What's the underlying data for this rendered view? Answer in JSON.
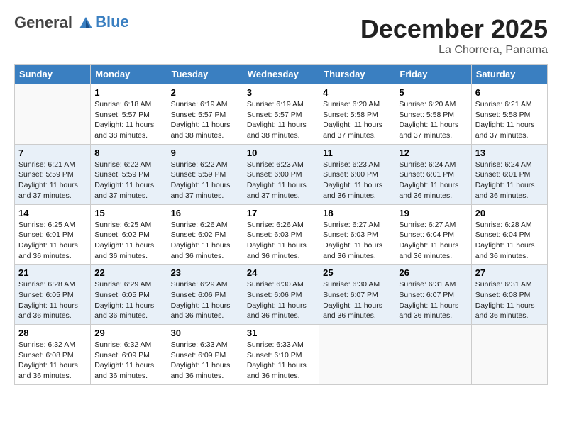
{
  "header": {
    "logo_line1": "General",
    "logo_line2": "Blue",
    "month": "December 2025",
    "location": "La Chorrera, Panama"
  },
  "weekdays": [
    "Sunday",
    "Monday",
    "Tuesday",
    "Wednesday",
    "Thursday",
    "Friday",
    "Saturday"
  ],
  "weeks": [
    [
      {
        "day": "",
        "sunrise": "",
        "sunset": "",
        "daylight": ""
      },
      {
        "day": "1",
        "sunrise": "Sunrise: 6:18 AM",
        "sunset": "Sunset: 5:57 PM",
        "daylight": "Daylight: 11 hours and 38 minutes."
      },
      {
        "day": "2",
        "sunrise": "Sunrise: 6:19 AM",
        "sunset": "Sunset: 5:57 PM",
        "daylight": "Daylight: 11 hours and 38 minutes."
      },
      {
        "day": "3",
        "sunrise": "Sunrise: 6:19 AM",
        "sunset": "Sunset: 5:57 PM",
        "daylight": "Daylight: 11 hours and 38 minutes."
      },
      {
        "day": "4",
        "sunrise": "Sunrise: 6:20 AM",
        "sunset": "Sunset: 5:58 PM",
        "daylight": "Daylight: 11 hours and 37 minutes."
      },
      {
        "day": "5",
        "sunrise": "Sunrise: 6:20 AM",
        "sunset": "Sunset: 5:58 PM",
        "daylight": "Daylight: 11 hours and 37 minutes."
      },
      {
        "day": "6",
        "sunrise": "Sunrise: 6:21 AM",
        "sunset": "Sunset: 5:58 PM",
        "daylight": "Daylight: 11 hours and 37 minutes."
      }
    ],
    [
      {
        "day": "7",
        "sunrise": "Sunrise: 6:21 AM",
        "sunset": "Sunset: 5:59 PM",
        "daylight": "Daylight: 11 hours and 37 minutes."
      },
      {
        "day": "8",
        "sunrise": "Sunrise: 6:22 AM",
        "sunset": "Sunset: 5:59 PM",
        "daylight": "Daylight: 11 hours and 37 minutes."
      },
      {
        "day": "9",
        "sunrise": "Sunrise: 6:22 AM",
        "sunset": "Sunset: 5:59 PM",
        "daylight": "Daylight: 11 hours and 37 minutes."
      },
      {
        "day": "10",
        "sunrise": "Sunrise: 6:23 AM",
        "sunset": "Sunset: 6:00 PM",
        "daylight": "Daylight: 11 hours and 37 minutes."
      },
      {
        "day": "11",
        "sunrise": "Sunrise: 6:23 AM",
        "sunset": "Sunset: 6:00 PM",
        "daylight": "Daylight: 11 hours and 36 minutes."
      },
      {
        "day": "12",
        "sunrise": "Sunrise: 6:24 AM",
        "sunset": "Sunset: 6:01 PM",
        "daylight": "Daylight: 11 hours and 36 minutes."
      },
      {
        "day": "13",
        "sunrise": "Sunrise: 6:24 AM",
        "sunset": "Sunset: 6:01 PM",
        "daylight": "Daylight: 11 hours and 36 minutes."
      }
    ],
    [
      {
        "day": "14",
        "sunrise": "Sunrise: 6:25 AM",
        "sunset": "Sunset: 6:01 PM",
        "daylight": "Daylight: 11 hours and 36 minutes."
      },
      {
        "day": "15",
        "sunrise": "Sunrise: 6:25 AM",
        "sunset": "Sunset: 6:02 PM",
        "daylight": "Daylight: 11 hours and 36 minutes."
      },
      {
        "day": "16",
        "sunrise": "Sunrise: 6:26 AM",
        "sunset": "Sunset: 6:02 PM",
        "daylight": "Daylight: 11 hours and 36 minutes."
      },
      {
        "day": "17",
        "sunrise": "Sunrise: 6:26 AM",
        "sunset": "Sunset: 6:03 PM",
        "daylight": "Daylight: 11 hours and 36 minutes."
      },
      {
        "day": "18",
        "sunrise": "Sunrise: 6:27 AM",
        "sunset": "Sunset: 6:03 PM",
        "daylight": "Daylight: 11 hours and 36 minutes."
      },
      {
        "day": "19",
        "sunrise": "Sunrise: 6:27 AM",
        "sunset": "Sunset: 6:04 PM",
        "daylight": "Daylight: 11 hours and 36 minutes."
      },
      {
        "day": "20",
        "sunrise": "Sunrise: 6:28 AM",
        "sunset": "Sunset: 6:04 PM",
        "daylight": "Daylight: 11 hours and 36 minutes."
      }
    ],
    [
      {
        "day": "21",
        "sunrise": "Sunrise: 6:28 AM",
        "sunset": "Sunset: 6:05 PM",
        "daylight": "Daylight: 11 hours and 36 minutes."
      },
      {
        "day": "22",
        "sunrise": "Sunrise: 6:29 AM",
        "sunset": "Sunset: 6:05 PM",
        "daylight": "Daylight: 11 hours and 36 minutes."
      },
      {
        "day": "23",
        "sunrise": "Sunrise: 6:29 AM",
        "sunset": "Sunset: 6:06 PM",
        "daylight": "Daylight: 11 hours and 36 minutes."
      },
      {
        "day": "24",
        "sunrise": "Sunrise: 6:30 AM",
        "sunset": "Sunset: 6:06 PM",
        "daylight": "Daylight: 11 hours and 36 minutes."
      },
      {
        "day": "25",
        "sunrise": "Sunrise: 6:30 AM",
        "sunset": "Sunset: 6:07 PM",
        "daylight": "Daylight: 11 hours and 36 minutes."
      },
      {
        "day": "26",
        "sunrise": "Sunrise: 6:31 AM",
        "sunset": "Sunset: 6:07 PM",
        "daylight": "Daylight: 11 hours and 36 minutes."
      },
      {
        "day": "27",
        "sunrise": "Sunrise: 6:31 AM",
        "sunset": "Sunset: 6:08 PM",
        "daylight": "Daylight: 11 hours and 36 minutes."
      }
    ],
    [
      {
        "day": "28",
        "sunrise": "Sunrise: 6:32 AM",
        "sunset": "Sunset: 6:08 PM",
        "daylight": "Daylight: 11 hours and 36 minutes."
      },
      {
        "day": "29",
        "sunrise": "Sunrise: 6:32 AM",
        "sunset": "Sunset: 6:09 PM",
        "daylight": "Daylight: 11 hours and 36 minutes."
      },
      {
        "day": "30",
        "sunrise": "Sunrise: 6:33 AM",
        "sunset": "Sunset: 6:09 PM",
        "daylight": "Daylight: 11 hours and 36 minutes."
      },
      {
        "day": "31",
        "sunrise": "Sunrise: 6:33 AM",
        "sunset": "Sunset: 6:10 PM",
        "daylight": "Daylight: 11 hours and 36 minutes."
      },
      {
        "day": "",
        "sunrise": "",
        "sunset": "",
        "daylight": ""
      },
      {
        "day": "",
        "sunrise": "",
        "sunset": "",
        "daylight": ""
      },
      {
        "day": "",
        "sunrise": "",
        "sunset": "",
        "daylight": ""
      }
    ]
  ]
}
